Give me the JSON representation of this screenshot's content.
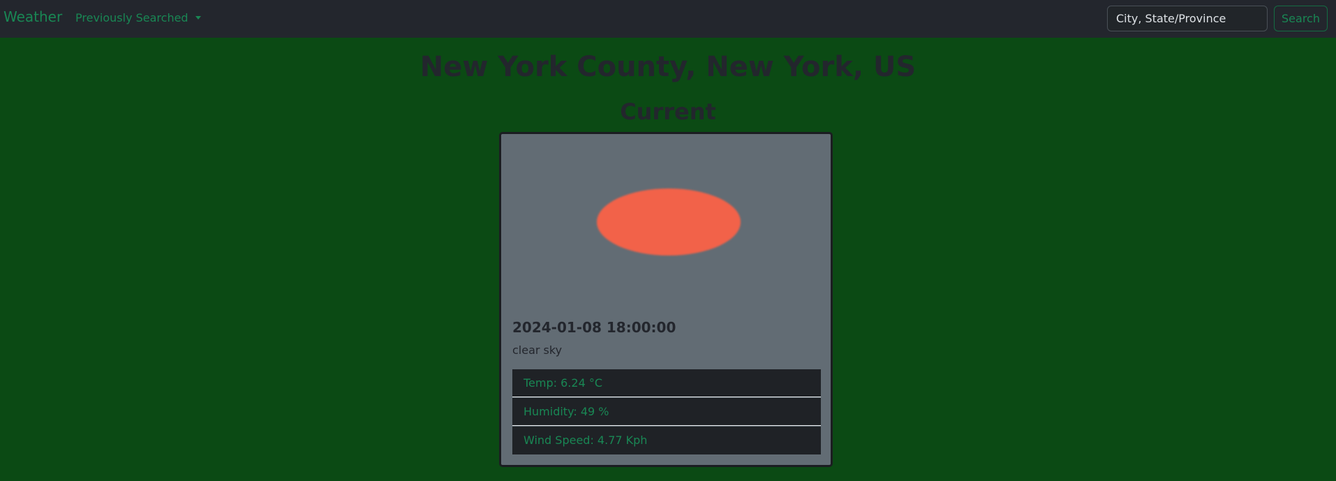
{
  "navbar": {
    "brand": "Weather",
    "dropdown_label": "Previously Searched",
    "search_placeholder": "City, State/Province",
    "search_button": "Search"
  },
  "location": {
    "title": "New York County, New York, US"
  },
  "current": {
    "heading": "Current",
    "icon": "sun-icon",
    "icon_color": "#f26249",
    "datetime": "2024-01-08 18:00:00",
    "description": "clear sky",
    "stats": [
      "Temp: 6.24 °C",
      "Humidity: 49 %",
      "Wind Speed: 4.77 Kph"
    ]
  },
  "colors": {
    "background": "#0b4a14",
    "navbar": "#23262d",
    "accent": "#198754",
    "card": "#626c74",
    "stat_bg": "#1f2226"
  }
}
